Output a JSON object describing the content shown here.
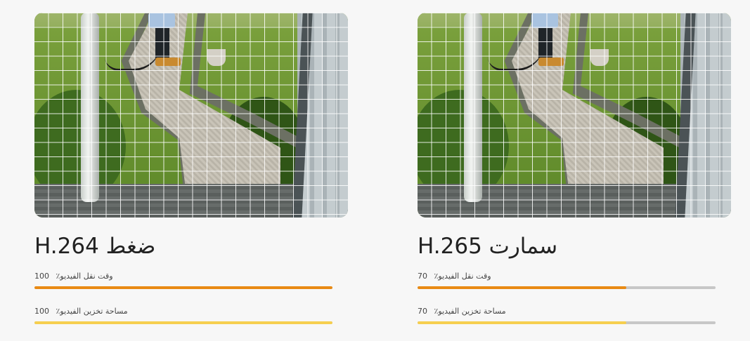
{
  "colors": {
    "transfer_bar": "#e98a14",
    "storage_bar": "#f6cf4f",
    "track": "#c7c7c7"
  },
  "cards": [
    {
      "title": "H.264 ضغط",
      "image_alt_icon": "garden-path-photo",
      "metrics": [
        {
          "value": "100",
          "label": "٪وقت نقل الفيديو",
          "fraction": 1.0,
          "kind": "transfer"
        },
        {
          "value": "100",
          "label": "٪مساحة تخزين الفيديو",
          "fraction": 1.0,
          "kind": "storage"
        }
      ]
    },
    {
      "title": "H.265 سمارت",
      "image_alt_icon": "garden-path-photo",
      "metrics": [
        {
          "value": "70",
          "label": "٪وقت نقل الفيديو",
          "fraction": 0.7,
          "kind": "transfer"
        },
        {
          "value": "70",
          "label": "٪مساحة تخزين الفيديو",
          "fraction": 0.7,
          "kind": "storage"
        }
      ]
    }
  ]
}
